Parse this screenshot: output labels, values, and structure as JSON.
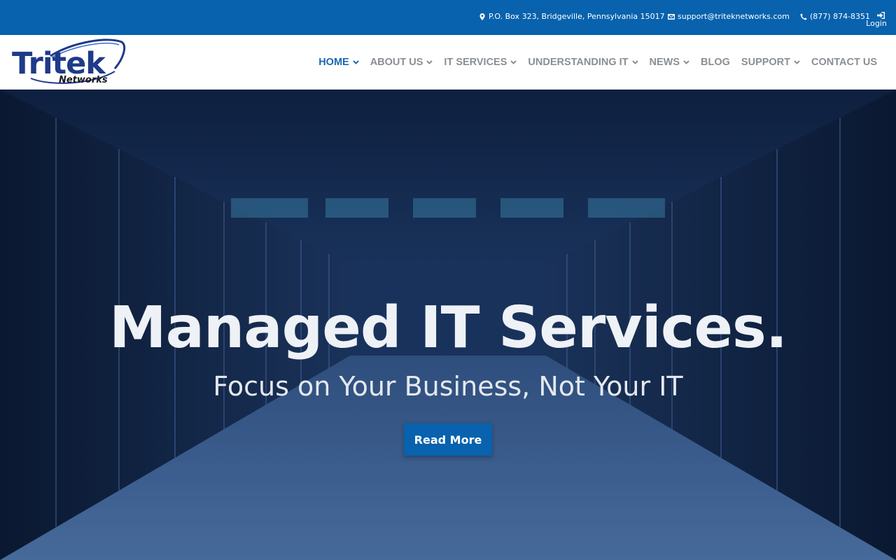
{
  "topbar": {
    "address": "P.O. Box 323, Bridgeville, Pennsylvania 15017",
    "email": "support@triteknetworks.com",
    "phone": "(877) 874-8351",
    "login": "Login",
    "address_icon": "map-marker-icon",
    "email_icon": "envelope-icon",
    "phone_icon": "phone-icon",
    "login_icon": "sign-in-icon"
  },
  "logo": {
    "name": "Tritek",
    "sub": "Networks"
  },
  "nav": {
    "items": [
      {
        "label": "HOME",
        "dropdown": true,
        "active": true
      },
      {
        "label": "ABOUT US",
        "dropdown": true
      },
      {
        "label": "IT SERVICES",
        "dropdown": true
      },
      {
        "label": "UNDERSTANDING IT",
        "dropdown": true
      },
      {
        "label": "NEWS",
        "dropdown": true
      },
      {
        "label": "BLOG",
        "dropdown": false
      },
      {
        "label": "SUPPORT",
        "dropdown": true
      },
      {
        "label": "CONTACT US",
        "dropdown": false
      }
    ]
  },
  "hero": {
    "title": "Managed IT Services.",
    "subtitle": "Focus on Your Business, Not Your IT",
    "button": "Read More"
  },
  "colors": {
    "brand_blue": "#0862ad",
    "nav_active": "#1a67ae",
    "nav_text": "#8a8f94",
    "logo_blue": "#1e3a8a"
  }
}
